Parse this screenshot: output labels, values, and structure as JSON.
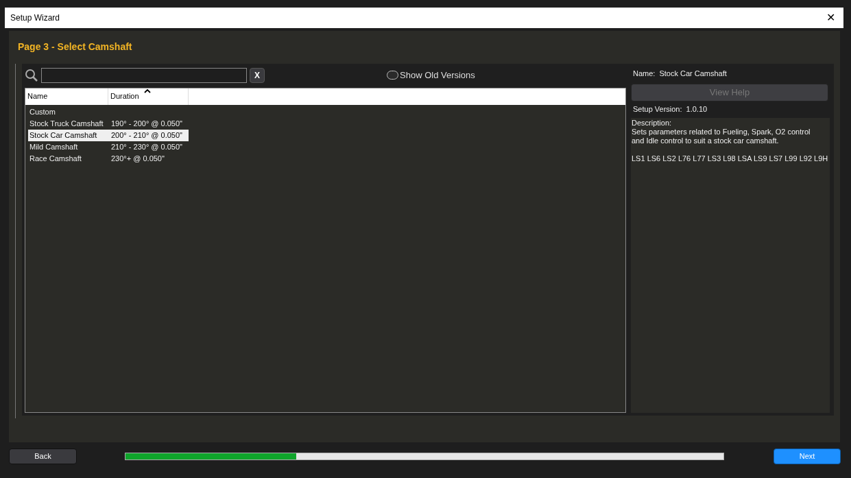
{
  "window": {
    "title": "Setup Wizard",
    "close": "✕"
  },
  "page_title": "Page 3 - Select Camshaft",
  "search": {
    "clear": "X"
  },
  "show_old_versions": {
    "label": "Show Old Versions",
    "on": false
  },
  "table": {
    "columns": [
      {
        "label": "Name",
        "sorted": false
      },
      {
        "label": "Duration",
        "sorted": true
      }
    ],
    "rows": [
      {
        "name": "Custom",
        "duration": "",
        "selected": false
      },
      {
        "name": "Stock Truck Camshaft",
        "duration": "190° - 200° @ 0.050\"",
        "selected": false
      },
      {
        "name": "Stock Car Camshaft",
        "duration": "200° - 210° @ 0.050\"",
        "selected": true
      },
      {
        "name": "Mild Camshaft",
        "duration": "210° - 230° @ 0.050\"",
        "selected": false
      },
      {
        "name": "Race Camshaft",
        "duration": "230°+ @ 0.050\"",
        "selected": false
      }
    ]
  },
  "details": {
    "name_label": "Name:",
    "name_value": "Stock Car Camshaft",
    "view_help": {
      "label": "View Help",
      "disabled": true
    },
    "version_label": "Setup Version:",
    "version_value": "1.0.10",
    "description_label": "Description:",
    "description": "Sets parameters related to Fueling, Spark, O2 control and Idle control to suit a stock car camshaft.",
    "engines": "LS1 LS6 LS2 L76 L77 LS3 L98 LSA LS9 LS7 L99 L92 L9H"
  },
  "footer": {
    "back": "Back",
    "progress": {
      "level": 0.285
    },
    "next": "Next"
  }
}
